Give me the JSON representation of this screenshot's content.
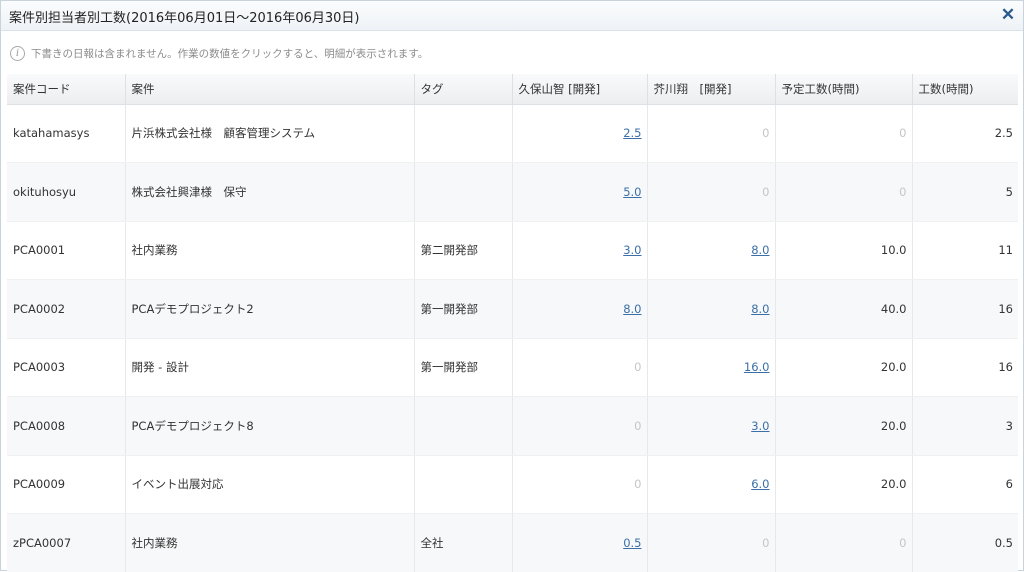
{
  "window": {
    "title": "案件別担当者別工数(2016年06月01日～2016年06月30日)",
    "close_label": "✕"
  },
  "info": {
    "icon": "info-icon",
    "text": "下書きの日報は含まれません。作業の数値をクリックすると、明細が表示されます。"
  },
  "table": {
    "columns": [
      "案件コード",
      "案件",
      "タグ",
      "久保山智 [開発]",
      "芥川翔　[開発]",
      "予定工数(時間)",
      "工数(時間)"
    ],
    "rows": [
      {
        "code": "katahamasys",
        "project": "片浜株式会社様　顧客管理システム",
        "tag": "",
        "kubo": "2.5",
        "akuta": "0",
        "planned": "0",
        "total": "2.5"
      },
      {
        "code": "okituhosyu",
        "project": "株式会社興津様　保守",
        "tag": "",
        "kubo": "5.0",
        "akuta": "0",
        "planned": "0",
        "total": "5"
      },
      {
        "code": "PCA0001",
        "project": "社内業務",
        "tag": "第二開発部",
        "kubo": "3.0",
        "akuta": "8.0",
        "planned": "10.0",
        "total": "11"
      },
      {
        "code": "PCA0002",
        "project": "PCAデモプロジェクト2",
        "tag": "第一開発部",
        "kubo": "8.0",
        "akuta": "8.0",
        "planned": "40.0",
        "total": "16"
      },
      {
        "code": "PCA0003",
        "project": "開発 - 設計",
        "tag": "第一開発部",
        "kubo": "0",
        "akuta": "16.0",
        "planned": "20.0",
        "total": "16"
      },
      {
        "code": "PCA0008",
        "project": "PCAデモプロジェクト8",
        "tag": "",
        "kubo": "0",
        "akuta": "3.0",
        "planned": "20.0",
        "total": "3"
      },
      {
        "code": "PCA0009",
        "project": "イベント出展対応",
        "tag": "",
        "kubo": "0",
        "akuta": "6.0",
        "planned": "20.0",
        "total": "6"
      },
      {
        "code": "zPCA0007",
        "project": "社内業務",
        "tag": "全社",
        "kubo": "0.5",
        "akuta": "0",
        "planned": "0",
        "total": "0.5"
      }
    ]
  },
  "colors": {
    "link": "#3a6fa8",
    "zero": "#c6c6c6",
    "close": "#2a5a8e"
  }
}
